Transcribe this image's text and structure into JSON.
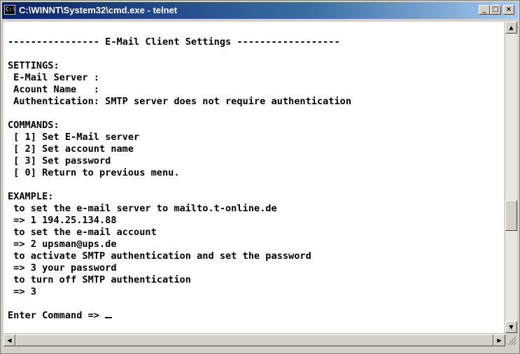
{
  "window": {
    "title": "C:\\WINNT\\System32\\cmd.exe - telnet",
    "icon": "cmd-icon"
  },
  "titlebar_buttons": {
    "minimize": "_",
    "maximize": "□",
    "close": "×"
  },
  "console": {
    "lines": [
      "",
      "---------------- E-Mail Client Settings ------------------",
      "",
      "SETTINGS:",
      " E-Mail Server :",
      " Acount Name   :",
      " Authentication: SMTP server does not require authentication",
      "",
      "COMMANDS:",
      " [ 1] Set E-Mail server",
      " [ 2] Set account name",
      " [ 3] Set password",
      " [ 0] Return to previous menu.",
      "",
      "EXAMPLE:",
      " to set the e-mail server to mailto.t-online.de",
      " => 1 194.25.134.88",
      " to set the e-mail account",
      " => 2 upsman@ups.de",
      " to activate SMTP authentication and set the password",
      " => 3 your password",
      " to turn off SMTP authentication",
      " => 3",
      "",
      "Enter Command => "
    ]
  },
  "scrollbars": {
    "up": "▲",
    "down": "▼",
    "left": "◀",
    "right": "▶"
  }
}
